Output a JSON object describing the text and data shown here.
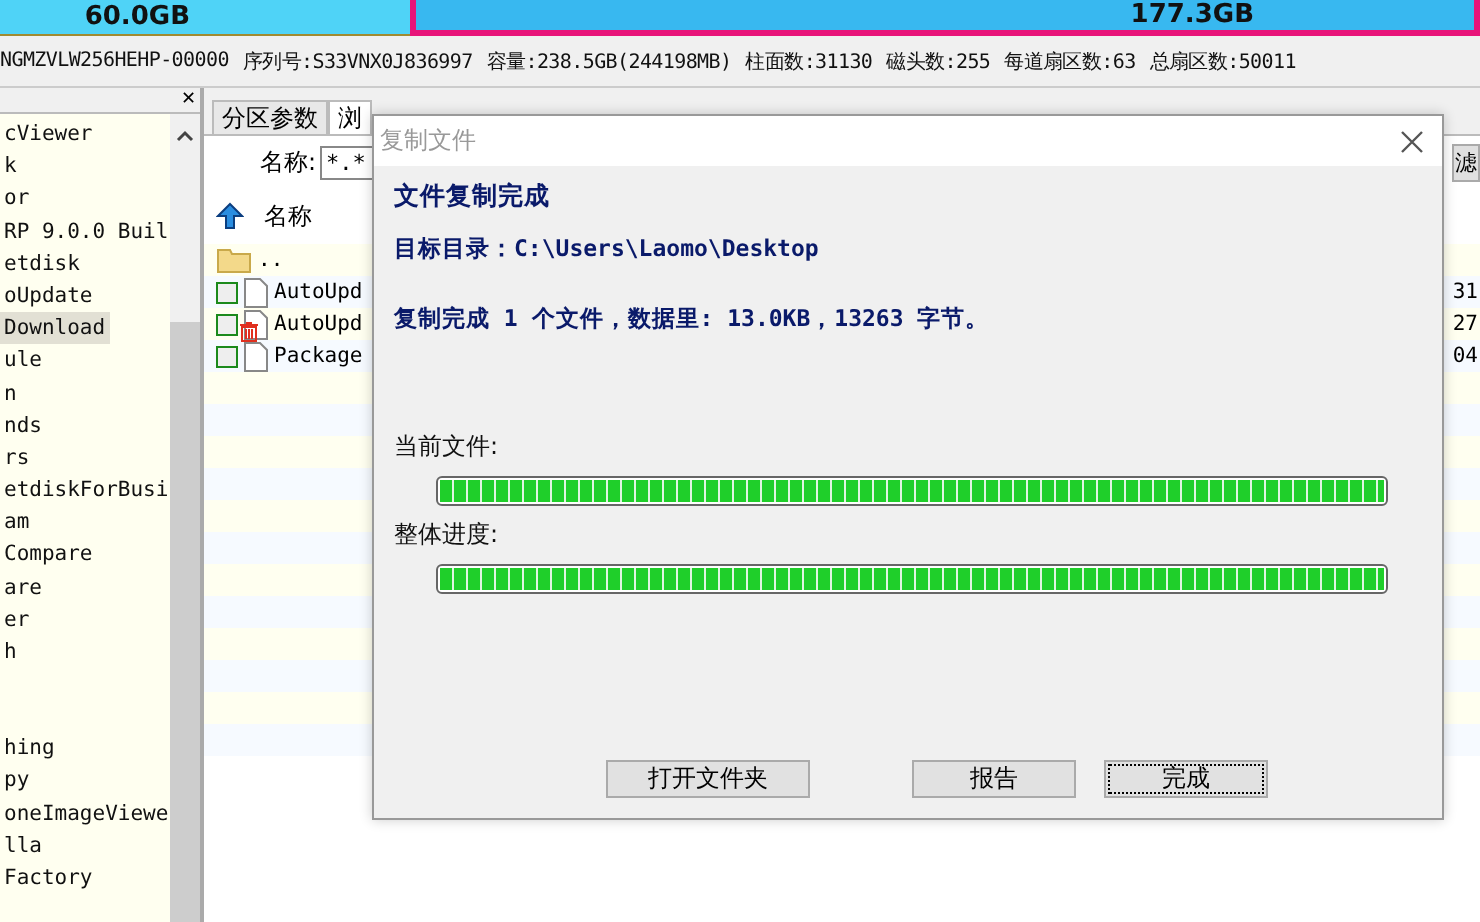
{
  "disk_bar": {
    "segments": [
      {
        "label": "60.0GB",
        "selected": false
      },
      {
        "label": "177.3GB",
        "selected": true
      }
    ]
  },
  "disk_info": [
    "NGMZVLW256HEHP-00000",
    "序列号:S33VNX0J836997",
    "容量:238.5GB(244198MB)",
    "柱面数:31130",
    "磁头数:255",
    "每道扇区数:63",
    "总扇区数:50011"
  ],
  "sidebar": {
    "close": "✕",
    "items": [
      {
        "label": "cViewer",
        "selected": false
      },
      {
        "label": "k",
        "selected": false
      },
      {
        "label": "or",
        "selected": false
      },
      {
        "label": "RP 9.0.0 Buil",
        "selected": false
      },
      {
        "label": "etdisk",
        "selected": false
      },
      {
        "label": "oUpdate",
        "selected": false
      },
      {
        "label": "Download",
        "selected": true
      },
      {
        "label": "ule",
        "selected": false
      },
      {
        "label": "n",
        "selected": false
      },
      {
        "label": "nds",
        "selected": false
      },
      {
        "label": "rs",
        "selected": false
      },
      {
        "label": "etdiskForBusi",
        "selected": false
      },
      {
        "label": "am",
        "selected": false
      },
      {
        "label": "Compare",
        "selected": false
      },
      {
        "label": "are",
        "selected": false
      },
      {
        "label": "er",
        "selected": false
      },
      {
        "label": "h",
        "selected": false
      },
      {
        "label": "hing",
        "selected": false
      },
      {
        "label": "py",
        "selected": false
      },
      {
        "label": "oneImageViewe",
        "selected": false
      },
      {
        "label": "lla",
        "selected": false
      },
      {
        "label": "Factory",
        "selected": false
      }
    ]
  },
  "tabs": [
    {
      "label": "分区参数",
      "selected": false
    },
    {
      "label": "浏",
      "selected": true
    }
  ],
  "filter": {
    "label": "名称:",
    "value": "*.*",
    "button": "滤"
  },
  "file_list": {
    "header": "名称",
    "rows": [
      {
        "kind": "parent",
        "name": ".."
      },
      {
        "kind": "file",
        "name": "AutoUpd",
        "checked": false,
        "deleted": false,
        "column_2": "31"
      },
      {
        "kind": "file",
        "name": "AutoUpd",
        "checked": false,
        "deleted": true,
        "column_2": "27"
      },
      {
        "kind": "file",
        "name": "Package",
        "checked": false,
        "deleted": false,
        "column_2": "04"
      }
    ]
  },
  "dialog": {
    "title": "复制文件",
    "heading": "文件复制完成",
    "target": "目标目录：C:\\Users\\Laomo\\Desktop",
    "summary": "复制完成 1 个文件，数据里: 13.0KB，13263 字节。",
    "progress": [
      {
        "label": "当前文件:",
        "level": 1
      },
      {
        "label": "整体进度:",
        "level": 1
      }
    ],
    "buttons": [
      {
        "label": "打开文件夹",
        "focused": false
      },
      {
        "label": "报告",
        "focused": false
      },
      {
        "label": "完成",
        "focused": true
      }
    ]
  }
}
